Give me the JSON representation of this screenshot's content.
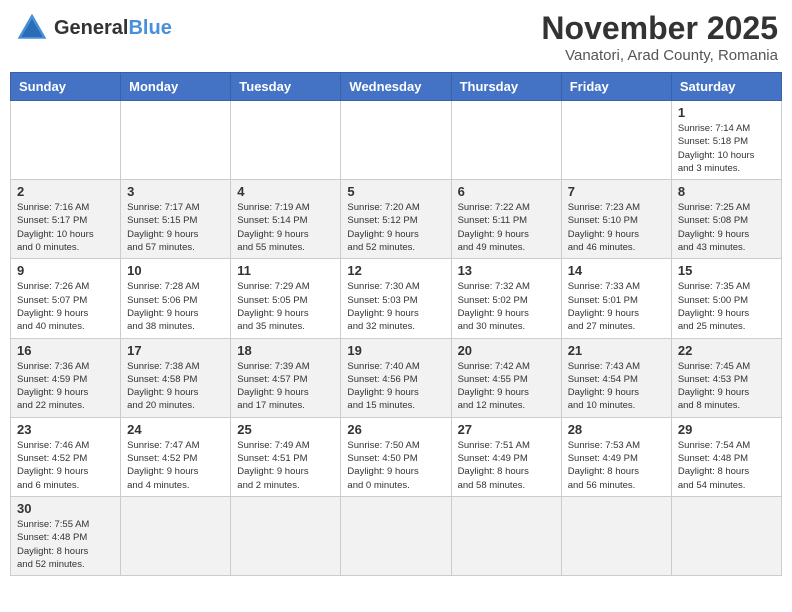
{
  "logo": {
    "text_general": "General",
    "text_blue": "Blue"
  },
  "header": {
    "title": "November 2025",
    "subtitle": "Vanatori, Arad County, Romania"
  },
  "weekdays": [
    "Sunday",
    "Monday",
    "Tuesday",
    "Wednesday",
    "Thursday",
    "Friday",
    "Saturday"
  ],
  "weeks": [
    [
      {
        "day": "",
        "info": ""
      },
      {
        "day": "",
        "info": ""
      },
      {
        "day": "",
        "info": ""
      },
      {
        "day": "",
        "info": ""
      },
      {
        "day": "",
        "info": ""
      },
      {
        "day": "",
        "info": ""
      },
      {
        "day": "1",
        "info": "Sunrise: 7:14 AM\nSunset: 5:18 PM\nDaylight: 10 hours\nand 3 minutes."
      }
    ],
    [
      {
        "day": "2",
        "info": "Sunrise: 7:16 AM\nSunset: 5:17 PM\nDaylight: 10 hours\nand 0 minutes."
      },
      {
        "day": "3",
        "info": "Sunrise: 7:17 AM\nSunset: 5:15 PM\nDaylight: 9 hours\nand 57 minutes."
      },
      {
        "day": "4",
        "info": "Sunrise: 7:19 AM\nSunset: 5:14 PM\nDaylight: 9 hours\nand 55 minutes."
      },
      {
        "day": "5",
        "info": "Sunrise: 7:20 AM\nSunset: 5:12 PM\nDaylight: 9 hours\nand 52 minutes."
      },
      {
        "day": "6",
        "info": "Sunrise: 7:22 AM\nSunset: 5:11 PM\nDaylight: 9 hours\nand 49 minutes."
      },
      {
        "day": "7",
        "info": "Sunrise: 7:23 AM\nSunset: 5:10 PM\nDaylight: 9 hours\nand 46 minutes."
      },
      {
        "day": "8",
        "info": "Sunrise: 7:25 AM\nSunset: 5:08 PM\nDaylight: 9 hours\nand 43 minutes."
      }
    ],
    [
      {
        "day": "9",
        "info": "Sunrise: 7:26 AM\nSunset: 5:07 PM\nDaylight: 9 hours\nand 40 minutes."
      },
      {
        "day": "10",
        "info": "Sunrise: 7:28 AM\nSunset: 5:06 PM\nDaylight: 9 hours\nand 38 minutes."
      },
      {
        "day": "11",
        "info": "Sunrise: 7:29 AM\nSunset: 5:05 PM\nDaylight: 9 hours\nand 35 minutes."
      },
      {
        "day": "12",
        "info": "Sunrise: 7:30 AM\nSunset: 5:03 PM\nDaylight: 9 hours\nand 32 minutes."
      },
      {
        "day": "13",
        "info": "Sunrise: 7:32 AM\nSunset: 5:02 PM\nDaylight: 9 hours\nand 30 minutes."
      },
      {
        "day": "14",
        "info": "Sunrise: 7:33 AM\nSunset: 5:01 PM\nDaylight: 9 hours\nand 27 minutes."
      },
      {
        "day": "15",
        "info": "Sunrise: 7:35 AM\nSunset: 5:00 PM\nDaylight: 9 hours\nand 25 minutes."
      }
    ],
    [
      {
        "day": "16",
        "info": "Sunrise: 7:36 AM\nSunset: 4:59 PM\nDaylight: 9 hours\nand 22 minutes."
      },
      {
        "day": "17",
        "info": "Sunrise: 7:38 AM\nSunset: 4:58 PM\nDaylight: 9 hours\nand 20 minutes."
      },
      {
        "day": "18",
        "info": "Sunrise: 7:39 AM\nSunset: 4:57 PM\nDaylight: 9 hours\nand 17 minutes."
      },
      {
        "day": "19",
        "info": "Sunrise: 7:40 AM\nSunset: 4:56 PM\nDaylight: 9 hours\nand 15 minutes."
      },
      {
        "day": "20",
        "info": "Sunrise: 7:42 AM\nSunset: 4:55 PM\nDaylight: 9 hours\nand 12 minutes."
      },
      {
        "day": "21",
        "info": "Sunrise: 7:43 AM\nSunset: 4:54 PM\nDaylight: 9 hours\nand 10 minutes."
      },
      {
        "day": "22",
        "info": "Sunrise: 7:45 AM\nSunset: 4:53 PM\nDaylight: 9 hours\nand 8 minutes."
      }
    ],
    [
      {
        "day": "23",
        "info": "Sunrise: 7:46 AM\nSunset: 4:52 PM\nDaylight: 9 hours\nand 6 minutes."
      },
      {
        "day": "24",
        "info": "Sunrise: 7:47 AM\nSunset: 4:52 PM\nDaylight: 9 hours\nand 4 minutes."
      },
      {
        "day": "25",
        "info": "Sunrise: 7:49 AM\nSunset: 4:51 PM\nDaylight: 9 hours\nand 2 minutes."
      },
      {
        "day": "26",
        "info": "Sunrise: 7:50 AM\nSunset: 4:50 PM\nDaylight: 9 hours\nand 0 minutes."
      },
      {
        "day": "27",
        "info": "Sunrise: 7:51 AM\nSunset: 4:49 PM\nDaylight: 8 hours\nand 58 minutes."
      },
      {
        "day": "28",
        "info": "Sunrise: 7:53 AM\nSunset: 4:49 PM\nDaylight: 8 hours\nand 56 minutes."
      },
      {
        "day": "29",
        "info": "Sunrise: 7:54 AM\nSunset: 4:48 PM\nDaylight: 8 hours\nand 54 minutes."
      }
    ],
    [
      {
        "day": "30",
        "info": "Sunrise: 7:55 AM\nSunset: 4:48 PM\nDaylight: 8 hours\nand 52 minutes."
      },
      {
        "day": "",
        "info": ""
      },
      {
        "day": "",
        "info": ""
      },
      {
        "day": "",
        "info": ""
      },
      {
        "day": "",
        "info": ""
      },
      {
        "day": "",
        "info": ""
      },
      {
        "day": "",
        "info": ""
      }
    ]
  ]
}
